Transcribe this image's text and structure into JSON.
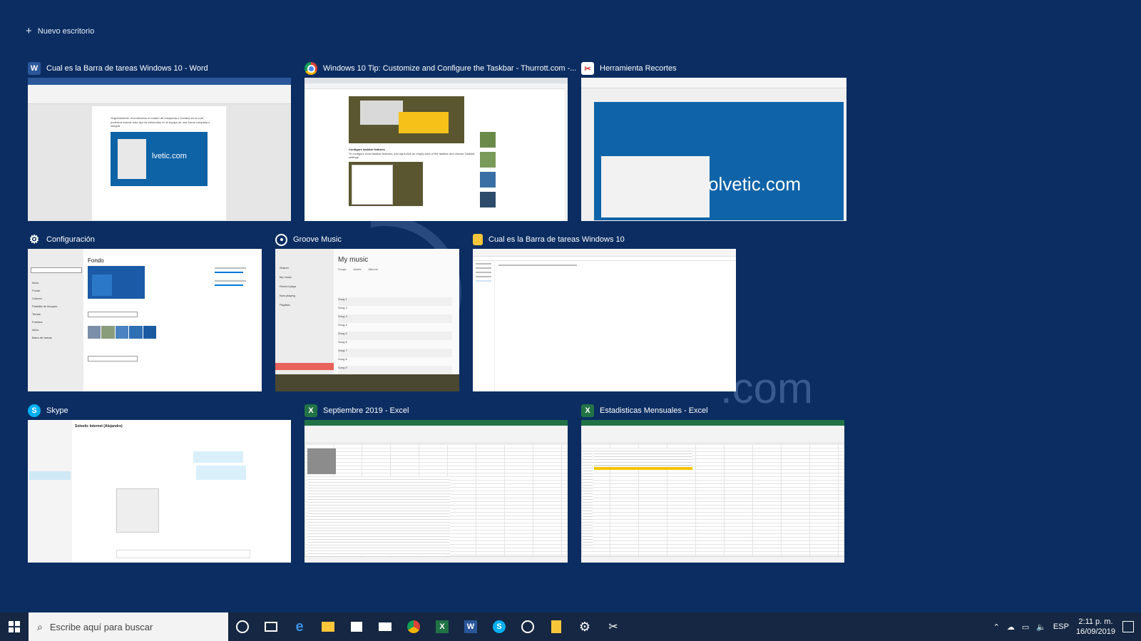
{
  "new_desktop": {
    "label": "Nuevo escritorio"
  },
  "watermark": {
    "text": ".com"
  },
  "windows": [
    {
      "title": "Cual es la Barra de tareas Windows 10 - Word",
      "icon": "word-icon",
      "brand": "#2b579a",
      "doc_text": "Seguidamente, encontramos el cuadro de búsqueda o Cortana en la cual podemos buscar todo tipo de elementos en el equipo de una forma completa e integral.",
      "logo": "lvetic.com"
    },
    {
      "title": "Windows 10 Tip: Customize and Configure the Taskbar - Thurrott.com -...",
      "icon": "chrome-icon",
      "body_bold": "Configure taskbar features",
      "body_text": "To configure most taskbar features, just right-click an empty area of the taskbar and choose Taskbar settings."
    },
    {
      "title": "Herramienta Recortes",
      "icon": "snipping-tool-icon",
      "logo": "olvetic.com"
    },
    {
      "title": "Configuración",
      "icon": "gear-icon",
      "heading": "Fondo",
      "nav": [
        "Inicio",
        "Fondo",
        "Colores",
        "Pantalla de bloqueo",
        "Temas",
        "Fuentes",
        "Inicio",
        "Barra de tareas"
      ]
    },
    {
      "title": "Groove Music",
      "icon": "groove-icon",
      "heading": "My music",
      "tabs": [
        "Songs",
        "Artists",
        "Albums"
      ],
      "nav": [
        "Search",
        "My music",
        "Recent plays",
        "Now playing",
        "Playlists"
      ],
      "songs": [
        "Song 1",
        "Song 2",
        "Song 3",
        "Song 4",
        "Song 5",
        "Song 6",
        "Song 7",
        "Song 8",
        "Song 9"
      ]
    },
    {
      "title": "Cual es la Barra de tareas Windows 10",
      "icon": "folder-icon"
    },
    {
      "title": "Skype",
      "icon": "skype-icon",
      "chat_title": "Solvetic Internet (Alejandro)"
    },
    {
      "title": "Septiembre  2019 - Excel",
      "icon": "excel-icon",
      "brand": "#217346"
    },
    {
      "title": "Estadisticas Mensuales - Excel",
      "icon": "excel-icon",
      "brand": "#217346"
    }
  ],
  "taskbar": {
    "search_placeholder": "Escribe aquí para buscar",
    "pinned": [
      "cortana-icon",
      "task-view-icon",
      "edge-icon",
      "file-explorer-icon",
      "store-icon",
      "mail-icon",
      "chrome-icon",
      "excel-icon",
      "word-icon",
      "skype-icon",
      "groove-icon",
      "notepad-icon",
      "settings-icon",
      "snipping-tool-icon"
    ],
    "lang": "ESP",
    "time": "2:11 p. m.",
    "date": "16/09/2019"
  },
  "colors": {
    "desktop_bg": "#0b2d62",
    "taskbar_bg": "#152742",
    "word": "#2b579a",
    "excel": "#217346",
    "accent": "#0063b1"
  }
}
